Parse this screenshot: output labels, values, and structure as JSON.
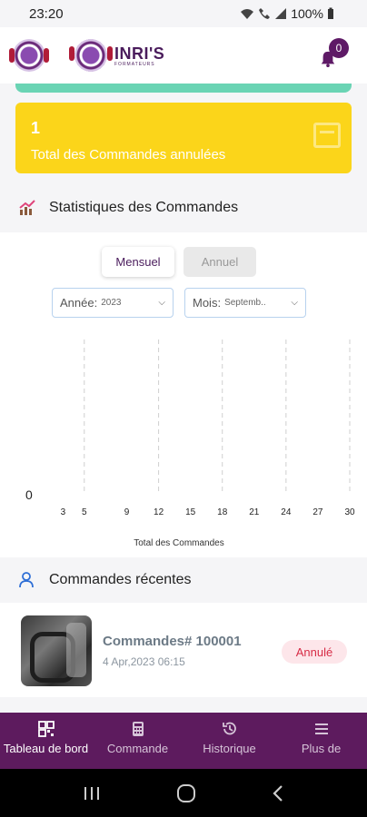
{
  "status_bar": {
    "time": "23:20",
    "battery": "100%"
  },
  "header": {
    "brand_name": "INRI'S",
    "brand_sub": "FORMATEURS",
    "notification_count": "0"
  },
  "cancelled_card": {
    "count": "1",
    "label": "Total des Commandes annulées",
    "color": "#fbd51a"
  },
  "stats": {
    "title": "Statistiques des Commandes",
    "toggle": {
      "monthly": "Mensuel",
      "yearly": "Annuel"
    },
    "year_select": {
      "label": "Année:",
      "value": "2023"
    },
    "month_select": {
      "label": "Mois:",
      "value": "Septemb.."
    }
  },
  "chart_data": {
    "type": "line",
    "x": [
      3,
      5,
      9,
      12,
      15,
      18,
      21,
      24,
      27,
      30
    ],
    "tick_labels": [
      "3",
      "5",
      "9",
      "12",
      "15",
      "18",
      "21",
      "24",
      "27",
      "30"
    ],
    "series": [
      {
        "values": [
          0,
          0,
          0,
          0,
          0,
          0,
          0,
          0,
          0,
          0
        ]
      }
    ],
    "y_tick_labels": [
      "0"
    ],
    "xlabel": "Total des Commandes",
    "ylabel": "",
    "grid": "vertical-dashed",
    "line_color_start": "#e0457b",
    "line_color_end": "#2b4aa8"
  },
  "recent": {
    "title": "Commandes récentes",
    "orders": [
      {
        "title": "Commandes# 100001",
        "date": "4 Apr,2023 06:15",
        "status": "Annulé"
      }
    ]
  },
  "bottom_nav": {
    "items": [
      {
        "label": "Tableau de bord",
        "icon": "dashboard-icon"
      },
      {
        "label": "Commande",
        "icon": "calculator-icon"
      },
      {
        "label": "Historique",
        "icon": "history-icon"
      },
      {
        "label": "Plus de",
        "icon": "menu-icon"
      }
    ]
  },
  "colors": {
    "primary": "#5d1b5e",
    "accent_teal": "#6ad4b4",
    "cancel_red": "#d72c46"
  }
}
